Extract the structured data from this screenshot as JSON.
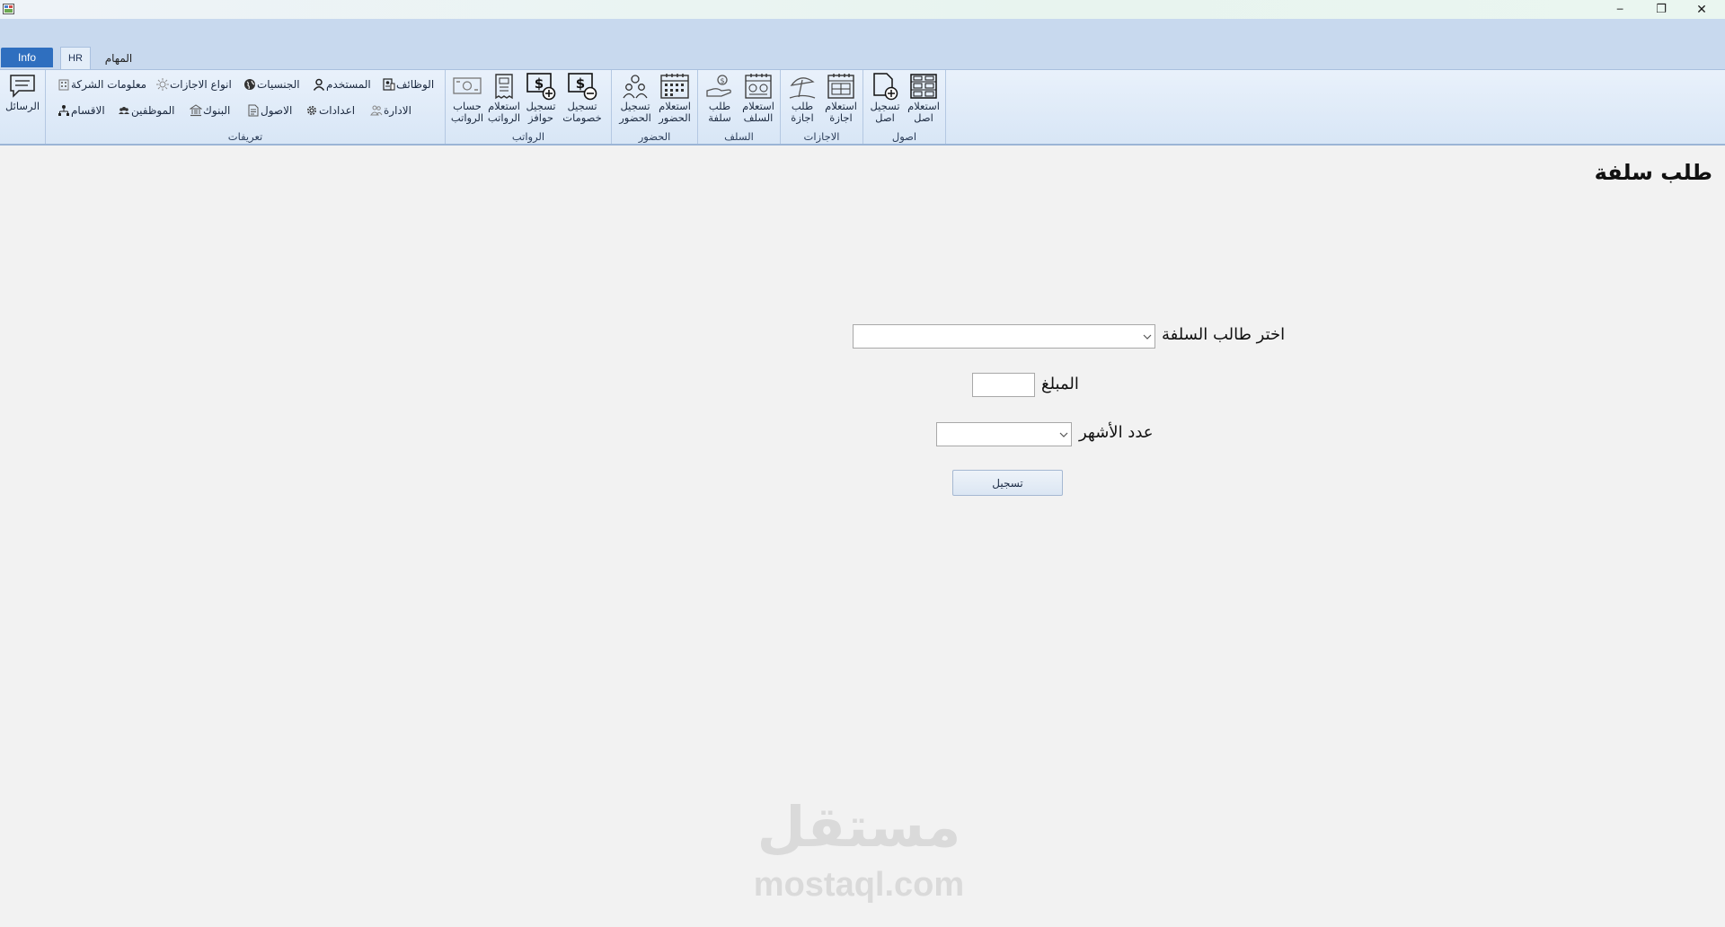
{
  "window": {
    "minimize_glyph": "─",
    "restore_glyph": "❐",
    "close_glyph": "✕"
  },
  "tabs": {
    "info": "Info",
    "hr": "HR",
    "tasks": "المهام"
  },
  "ribbon": {
    "messages": {
      "label": "الرسائل",
      "icon": "chat-icon"
    },
    "definitions": {
      "label": "تعريفات",
      "company_info": "معلومات الشركة",
      "leave_types": "انواع الاجازات",
      "nationalities": "الجنسيات",
      "user": "المستخدم",
      "jobs": "الوظائف",
      "departments": "الاقسام",
      "employees": "الموظفين",
      "banks": "البنوك",
      "assets": "الاصول",
      "settings": "اعدادات",
      "administration": "الادارة"
    },
    "salaries": {
      "label": "الرواتب",
      "calc_salaries": "حساب\nالرواتب",
      "query_salaries": "استعلام\nالرواتب",
      "register_incentives": "تسجيل\nحوافز",
      "register_deductions": "تسجيل\nخصومات"
    },
    "attendance": {
      "label": "الحضور",
      "register_attendance": "تسجيل\nالحضور",
      "query_attendance": "استعلام\nالحضور"
    },
    "advances": {
      "label": "السلف",
      "request_advance": "طلب\nسلفة",
      "query_advances": "استعلام\nالسلف"
    },
    "leaves": {
      "label": "الاجازات",
      "request_leave": "طلب\nاجازة",
      "query_leave": "استعلام\nاجازة"
    },
    "assets": {
      "label": "اصول",
      "register_asset": "تسجيل\nاصل",
      "query_asset": "استعلام\nاصل"
    }
  },
  "page": {
    "title": "طلب سلفة",
    "requester_label": "اختر طالب السلفة",
    "requester_value": "",
    "amount_label": "المبلغ",
    "amount_value": "",
    "months_label": "عدد الأشهر",
    "months_value": "",
    "submit_label": "تسجيل"
  },
  "watermark": {
    "arabic": "مستقل",
    "latin": "mostaql.com"
  }
}
